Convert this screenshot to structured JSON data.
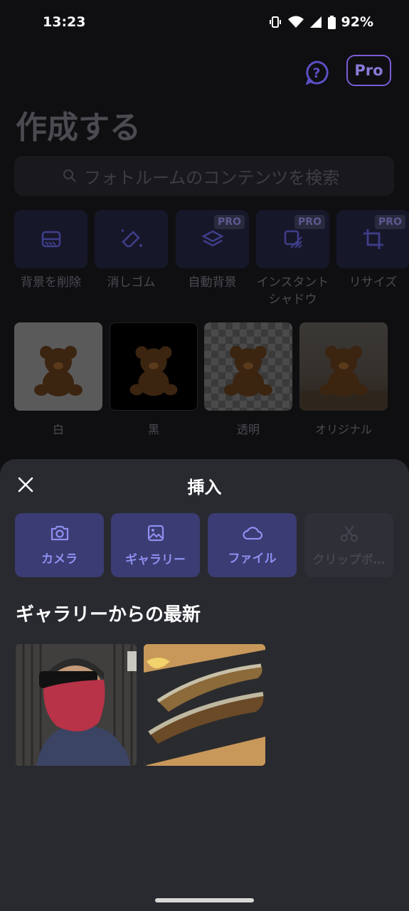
{
  "status": {
    "time": "13:23",
    "battery": "92%"
  },
  "header": {
    "pro_label": "Pro"
  },
  "page": {
    "title": "作成する"
  },
  "search": {
    "placeholder": "フォトルームのコンテンツを検索"
  },
  "tools": [
    {
      "label": "背景を削除",
      "pro": false,
      "icon": "erase-bg-icon"
    },
    {
      "label": "消しゴム",
      "pro": false,
      "icon": "eraser-icon"
    },
    {
      "label": "自動背景",
      "pro": true,
      "icon": "layers-icon"
    },
    {
      "label": "インスタントシャドウ",
      "pro": true,
      "icon": "shadow-icon"
    },
    {
      "label": "リサイズ",
      "pro": true,
      "icon": "crop-icon"
    }
  ],
  "pro_badge": "PRO",
  "backgrounds": [
    {
      "label": "白"
    },
    {
      "label": "黒"
    },
    {
      "label": "透明"
    },
    {
      "label": "オリジナル"
    }
  ],
  "sheet": {
    "title": "挿入",
    "insert_options": [
      {
        "label": "カメラ",
        "icon": "camera-icon",
        "enabled": true
      },
      {
        "label": "ギャラリー",
        "icon": "image-icon",
        "enabled": true
      },
      {
        "label": "ファイル",
        "icon": "cloud-icon",
        "enabled": true
      },
      {
        "label": "クリップボ…",
        "icon": "scissors-icon",
        "enabled": false
      }
    ],
    "recent_title": "ギャラリーからの最新"
  },
  "colors": {
    "accent": "#8f8ff0",
    "sheet_bg": "#292a30",
    "button_bg": "#3a3c73"
  }
}
